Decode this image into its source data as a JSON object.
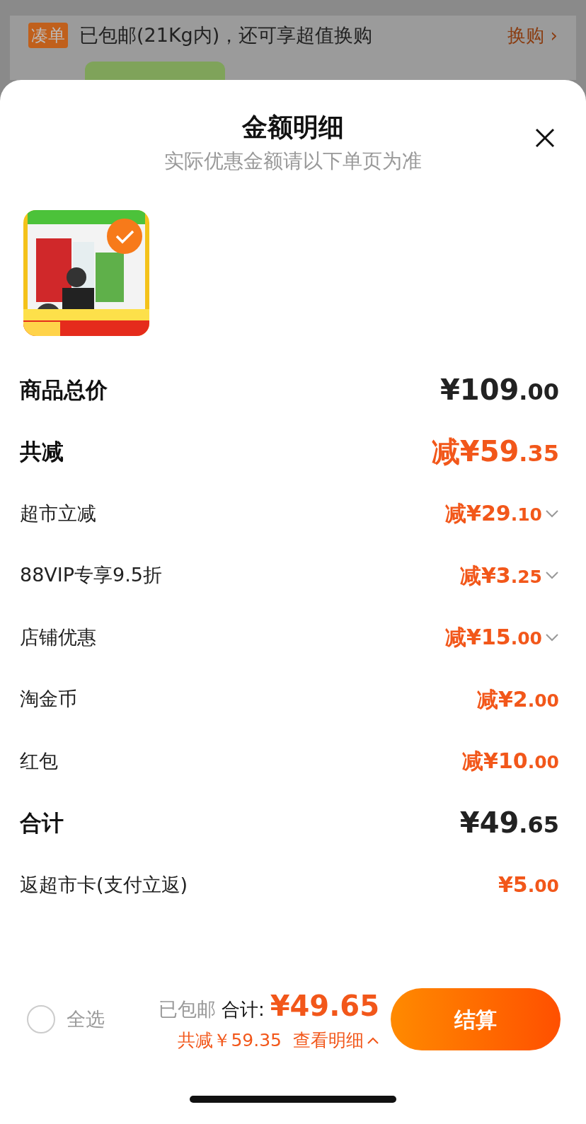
{
  "background": {
    "tag": "凑单",
    "notice": "已包邮(21Kg内)，还可享超值换购",
    "link": "换购 ›"
  },
  "sheet": {
    "title": "金额明细",
    "subtitle": "实际优惠金额请以下单页为准",
    "product": {
      "kind": "picture",
      "selected": true
    },
    "rows": [
      {
        "kind": "major",
        "label": "商品总价",
        "amount": "¥109.00",
        "highlight": false,
        "expandable": false
      },
      {
        "kind": "major",
        "label": "共减",
        "amount": "减¥59.35",
        "highlight": true,
        "expandable": false
      },
      {
        "kind": "minor",
        "label": "超市立减",
        "amount": "减¥29.10",
        "highlight": true,
        "expandable": true
      },
      {
        "kind": "minor",
        "label": "88VIP专享9.5折",
        "amount": "减¥3.25",
        "highlight": true,
        "expandable": true
      },
      {
        "kind": "minor",
        "label": "店铺优惠",
        "amount": "减¥15.00",
        "highlight": true,
        "expandable": true
      },
      {
        "kind": "minor",
        "label": "淘金币",
        "amount": "减¥2.00",
        "highlight": true,
        "expandable": false
      },
      {
        "kind": "minor",
        "label": "红包",
        "amount": "减¥10.00",
        "highlight": true,
        "expandable": false
      },
      {
        "kind": "major",
        "label": "合计",
        "amount": "¥49.65",
        "highlight": false,
        "expandable": false
      },
      {
        "kind": "minor",
        "label": "返超市卡(支付立返)",
        "amount": "¥5.00",
        "highlight": true,
        "expandable": false
      }
    ]
  },
  "bottom_bar": {
    "select_all": {
      "label": "全选",
      "checked": false
    },
    "shipping": "已包邮",
    "total_label": "合计:",
    "total": "¥49.65",
    "discount": "共减￥59.35",
    "details": "查看明细",
    "checkout": "结算"
  }
}
